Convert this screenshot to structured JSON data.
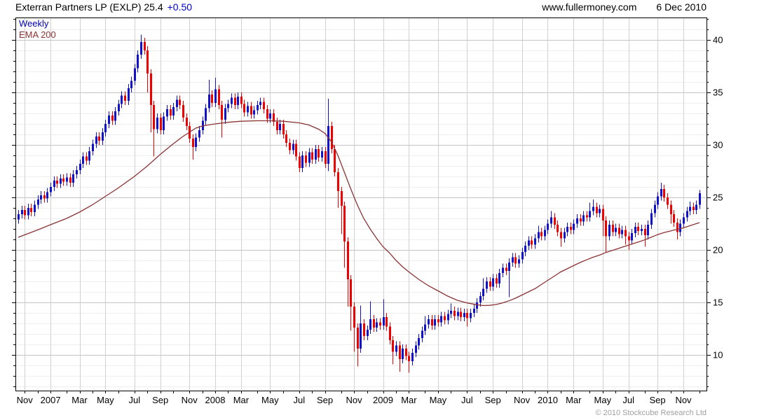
{
  "header": {
    "title": "Exterran Partners LP (EXLP) 25.4",
    "change": "+0.50",
    "website": "www.fullermoney.com",
    "date": "6 Dec 2010"
  },
  "legend": {
    "timeframe": "Weekly",
    "indicator": "EMA 200"
  },
  "footer": {
    "copyright": "© 2010 Stockcube Research Ltd"
  },
  "colors": {
    "up": "#1111cc",
    "down": "#ee0000",
    "ema": "#8b3333",
    "legend_timeframe": "#0000b4",
    "change": "#0000cc",
    "grid_minor": "#efefef",
    "grid_major": "#c4c4c4",
    "grid_vertical": "#d2d2d2",
    "axis": "#000000",
    "copyright": "#a0a0a0"
  },
  "chart_data": {
    "type": "candlestick",
    "timeframe": "weekly",
    "title": "Exterran Partners LP (EXLP)",
    "last_price": 25.4,
    "change": "+0.50",
    "date_range": [
      "Oct 2006",
      "6 Dec 2010"
    ],
    "ylim": [
      6.6,
      42.13
    ],
    "y_major_ticks": [
      10,
      15,
      20,
      25,
      30,
      35,
      40
    ],
    "grid": "on",
    "legend_entries": [
      "Weekly",
      "EMA 200"
    ],
    "x_ticks": [
      {
        "label": "Nov",
        "idx": 2
      },
      {
        "label": "2007",
        "idx": 10
      },
      {
        "label": "Mar",
        "idx": 19
      },
      {
        "label": "May",
        "idx": 27
      },
      {
        "label": "Jul",
        "idx": 36
      },
      {
        "label": "Sep",
        "idx": 44
      },
      {
        "label": "Nov",
        "idx": 53
      },
      {
        "label": "2008",
        "idx": 61
      },
      {
        "label": "Mar",
        "idx": 69
      },
      {
        "label": "May",
        "idx": 78
      },
      {
        "label": "Jul",
        "idx": 87
      },
      {
        "label": "Sep",
        "idx": 95
      },
      {
        "label": "Nov",
        "idx": 104
      },
      {
        "label": "2009",
        "idx": 113
      },
      {
        "label": "Mar",
        "idx": 121
      },
      {
        "label": "May",
        "idx": 130
      },
      {
        "label": "Jul",
        "idx": 139
      },
      {
        "label": "Sep",
        "idx": 147
      },
      {
        "label": "Nov",
        "idx": 156
      },
      {
        "label": "2010",
        "idx": 164
      },
      {
        "label": "Mar",
        "idx": 172
      },
      {
        "label": "May",
        "idx": 181
      },
      {
        "label": "Jul",
        "idx": 189
      },
      {
        "label": "Sep",
        "idx": 198
      },
      {
        "label": "Nov",
        "idx": 206
      }
    ],
    "x_minor_tick_idx": [
      6,
      15,
      23,
      31,
      40,
      48,
      57,
      65,
      74,
      82,
      91,
      100,
      108,
      117,
      126,
      134,
      143,
      151,
      160,
      168,
      177,
      185,
      194,
      202,
      211
    ],
    "first_open": 22.9,
    "default_wick": 0.4,
    "weekly_closes": [
      23.4,
      23.8,
      23.3,
      24.0,
      23.6,
      24.3,
      24.8,
      25.2,
      24.9,
      25.5,
      26.0,
      26.6,
      26.3,
      26.8,
      26.5,
      26.9,
      26.4,
      27.2,
      27.6,
      28.2,
      28.9,
      28.5,
      29.4,
      30.1,
      30.8,
      30.4,
      31.2,
      32.0,
      32.8,
      32.3,
      33.2,
      33.9,
      34.7,
      34.2,
      35.4,
      36.1,
      37.3,
      38.6,
      39.8,
      39.0,
      36.8,
      33.8,
      31.5,
      32.6,
      31.4,
      32.7,
      33.4,
      32.8,
      33.6,
      34.3,
      33.8,
      32.6,
      31.8,
      30.6,
      29.8,
      30.7,
      31.4,
      32.3,
      33.5,
      34.8,
      34.0,
      35.3,
      33.8,
      32.4,
      33.5,
      33.9,
      34.5,
      33.8,
      34.6,
      33.9,
      33.1,
      33.7,
      32.9,
      33.3,
      33.8,
      34.1,
      33.4,
      32.5,
      33.0,
      32.2,
      31.4,
      32.0,
      31.0,
      30.2,
      29.5,
      30.1,
      28.9,
      27.8,
      29.0,
      28.3,
      29.3,
      28.6,
      29.6,
      28.8,
      29.4,
      28.2,
      31.8,
      29.6,
      27.4,
      25.6,
      24.2,
      20.8,
      17.2,
      14.6,
      12.6,
      10.6,
      13.0,
      11.8,
      12.4,
      13.4,
      12.6,
      13.1,
      12.8,
      13.6,
      12.7,
      11.4,
      10.3,
      10.9,
      9.6,
      10.6,
      9.9,
      9.4,
      10.2,
      10.9,
      11.6,
      12.3,
      12.9,
      13.4,
      12.8,
      13.4,
      13.1,
      13.7,
      13.3,
      13.9,
      14.2,
      13.7,
      14.1,
      13.6,
      14.0,
      13.5,
      14.0,
      14.4,
      15.0,
      15.6,
      16.3,
      17.0,
      16.5,
      17.3,
      16.8,
      17.8,
      18.3,
      18.0,
      18.8,
      19.3,
      18.7,
      19.1,
      19.8,
      20.4,
      20.9,
      20.5,
      21.1,
      21.7,
      21.3,
      21.9,
      22.5,
      23.1,
      22.4,
      21.7,
      21.1,
      21.7,
      22.2,
      21.9,
      22.5,
      23.0,
      22.7,
      23.3,
      23.1,
      23.7,
      24.1,
      23.5,
      23.9,
      22.8,
      21.3,
      22.4,
      21.7,
      22.1,
      21.5,
      21.9,
      21.3,
      20.9,
      21.6,
      22.2,
      21.8,
      22.0,
      21.4,
      22.4,
      23.5,
      24.3,
      25.1,
      25.8,
      25.0,
      24.3,
      23.4,
      22.6,
      21.7,
      22.5,
      23.1,
      23.7,
      24.1,
      23.8,
      24.3,
      25.4
    ],
    "wick_overrides": {
      "38": [
        40.5,
        null
      ],
      "40": [
        null,
        35.0
      ],
      "41": [
        null,
        31.2
      ],
      "42": [
        null,
        28.9
      ],
      "54": [
        null,
        28.6
      ],
      "59": [
        36.2,
        null
      ],
      "61": [
        36.4,
        null
      ],
      "63": [
        null,
        30.7
      ],
      "96": [
        34.4,
        27.5
      ],
      "99": [
        null,
        24.0
      ],
      "100": [
        null,
        21.5
      ],
      "101": [
        null,
        18.3
      ],
      "102": [
        null,
        14.6
      ],
      "103": [
        null,
        12.3
      ],
      "104": [
        null,
        10.3
      ],
      "105": [
        null,
        8.9
      ],
      "106": [
        14.7,
        null
      ],
      "109": [
        15.1,
        null
      ],
      "113": [
        15.3,
        null
      ],
      "116": [
        null,
        9.1
      ],
      "118": [
        null,
        8.4
      ],
      "121": [
        null,
        8.3
      ],
      "126": [
        13.7,
        null
      ],
      "134": [
        14.9,
        null
      ],
      "139": [
        null,
        12.7
      ],
      "144": [
        17.3,
        null
      ],
      "152": [
        null,
        15.5
      ],
      "161": [
        22.3,
        null
      ],
      "165": [
        23.7,
        null
      ],
      "168": [
        null,
        20.3
      ],
      "177": [
        24.5,
        null
      ],
      "178": [
        24.8,
        null
      ],
      "181": [
        null,
        21.3
      ],
      "182": [
        null,
        19.8
      ],
      "188": [
        null,
        20.5
      ],
      "189": [
        null,
        20.0
      ],
      "194": [
        null,
        20.3
      ],
      "199": [
        26.4,
        null
      ],
      "202": [
        null,
        22.5
      ],
      "204": [
        null,
        21.0
      ],
      "208": [
        24.6,
        null
      ],
      "211": [
        25.7,
        null
      ]
    },
    "ema200": [
      [
        0,
        21.2
      ],
      [
        6,
        21.9
      ],
      [
        10,
        22.4
      ],
      [
        15,
        23.0
      ],
      [
        19,
        23.6
      ],
      [
        23,
        24.3
      ],
      [
        27,
        25.1
      ],
      [
        31,
        25.9
      ],
      [
        36,
        27.0
      ],
      [
        40,
        28.0
      ],
      [
        44,
        29.1
      ],
      [
        48,
        30.1
      ],
      [
        51,
        30.8
      ],
      [
        53,
        31.2
      ],
      [
        55,
        31.6
      ],
      [
        57,
        31.8
      ],
      [
        61,
        32.0
      ],
      [
        65,
        32.15
      ],
      [
        69,
        32.25
      ],
      [
        74,
        32.3
      ],
      [
        78,
        32.3
      ],
      [
        82,
        32.25
      ],
      [
        87,
        32.1
      ],
      [
        90,
        31.9
      ],
      [
        93,
        31.5
      ],
      [
        95,
        31.1
      ],
      [
        97,
        30.3
      ],
      [
        99,
        29.0
      ],
      [
        101,
        27.4
      ],
      [
        103,
        25.8
      ],
      [
        105,
        24.3
      ],
      [
        107,
        23.0
      ],
      [
        109,
        22.0
      ],
      [
        111,
        21.1
      ],
      [
        113,
        20.3
      ],
      [
        115,
        19.7
      ],
      [
        117,
        19.0
      ],
      [
        119,
        18.4
      ],
      [
        121,
        17.9
      ],
      [
        124,
        17.2
      ],
      [
        127,
        16.6
      ],
      [
        130,
        16.1
      ],
      [
        133,
        15.6
      ],
      [
        136,
        15.2
      ],
      [
        139,
        14.95
      ],
      [
        142,
        14.78
      ],
      [
        144,
        14.7
      ],
      [
        146,
        14.72
      ],
      [
        148,
        14.8
      ],
      [
        150,
        14.95
      ],
      [
        152,
        15.15
      ],
      [
        154,
        15.4
      ],
      [
        156,
        15.7
      ],
      [
        158,
        16.0
      ],
      [
        160,
        16.3
      ],
      [
        162,
        16.7
      ],
      [
        164,
        17.1
      ],
      [
        166,
        17.5
      ],
      [
        168,
        17.9
      ],
      [
        170,
        18.2
      ],
      [
        172,
        18.5
      ],
      [
        174,
        18.8
      ],
      [
        176,
        19.05
      ],
      [
        178,
        19.3
      ],
      [
        180,
        19.5
      ],
      [
        182,
        19.75
      ],
      [
        184,
        19.95
      ],
      [
        186,
        20.15
      ],
      [
        188,
        20.35
      ],
      [
        190,
        20.55
      ],
      [
        192,
        20.75
      ],
      [
        194,
        20.95
      ],
      [
        196,
        21.2
      ],
      [
        198,
        21.45
      ],
      [
        200,
        21.65
      ],
      [
        202,
        21.8
      ],
      [
        204,
        21.95
      ],
      [
        206,
        22.1
      ],
      [
        208,
        22.3
      ],
      [
        211,
        22.6
      ]
    ]
  }
}
